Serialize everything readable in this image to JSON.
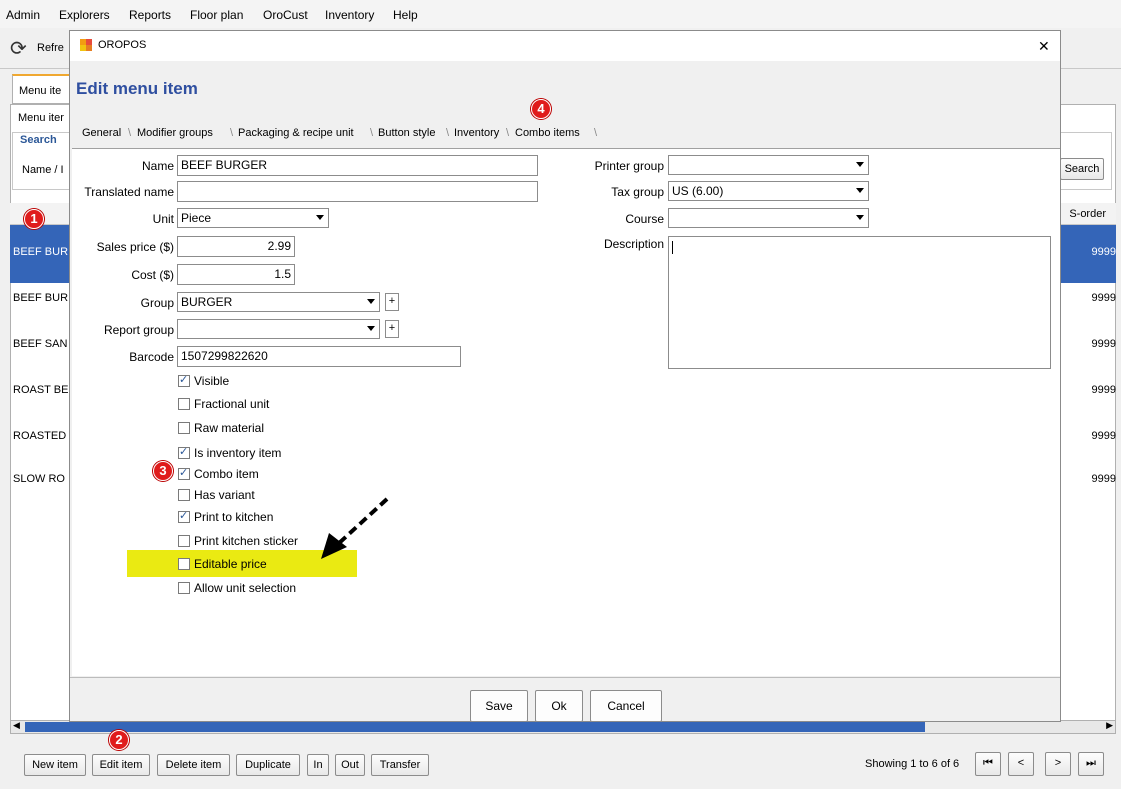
{
  "menubar": [
    "Admin",
    "Explorers",
    "Reports",
    "Floor plan",
    "OroCust",
    "Inventory",
    "Help"
  ],
  "toolbar": {
    "refresh_label": "Refre"
  },
  "background": {
    "tab_label": "Menu ite",
    "sub_label": "Menu iter",
    "search_group": "Search",
    "name_label": "Name / I",
    "search_button": "Search",
    "column_header": "S-order",
    "rows": [
      {
        "name": "BEEF BUR",
        "sort": "9999"
      },
      {
        "name": "BEEF BUR",
        "sort": "9999"
      },
      {
        "name": "BEEF SAN",
        "sort": "9999"
      },
      {
        "name": "ROAST BE",
        "sort": "9999"
      },
      {
        "name": "ROASTED",
        "sort": "9999"
      },
      {
        "name": "SLOW RO",
        "sort": "9999"
      }
    ],
    "bottom_buttons": [
      "New item",
      "Edit item",
      "Delete item",
      "Duplicate",
      "In",
      "Out",
      "Transfer"
    ],
    "paging_text": "Showing 1 to 6 of 6",
    "paging_icons": [
      "⏮",
      "<",
      ">",
      "⏭"
    ]
  },
  "dialog": {
    "window_title": "OROPOS",
    "close_glyph": "✕",
    "heading": "Edit menu item",
    "tabs": [
      "General",
      "Modifier groups",
      "Packaging & recipe unit",
      "Button style",
      "Inventory",
      "Combo items"
    ],
    "fields": {
      "name": {
        "label": "Name",
        "value": "BEEF BURGER"
      },
      "translated_name": {
        "label": "Translated name",
        "value": ""
      },
      "unit": {
        "label": "Unit",
        "value": "Piece"
      },
      "sales_price": {
        "label": "Sales price ($)",
        "value": "2.99"
      },
      "cost": {
        "label": "Cost ($)",
        "value": "1.5"
      },
      "group": {
        "label": "Group",
        "value": "BURGER",
        "plus": "+"
      },
      "report_group": {
        "label": "Report group",
        "value": "",
        "plus": "+"
      },
      "barcode": {
        "label": "Barcode",
        "value": "1507299822620"
      },
      "printer_group": {
        "label": "Printer group",
        "value": ""
      },
      "tax_group": {
        "label": "Tax group",
        "value": "US (6.00)"
      },
      "course": {
        "label": "Course",
        "value": ""
      },
      "description": {
        "label": "Description",
        "value": ""
      }
    },
    "checkboxes": [
      {
        "label": "Visible",
        "checked": true
      },
      {
        "label": "Fractional unit",
        "checked": false
      },
      {
        "label": "Raw material",
        "checked": false
      },
      {
        "label": "Is inventory item",
        "checked": true
      },
      {
        "label": "Combo item",
        "checked": true
      },
      {
        "label": "Has variant",
        "checked": false
      },
      {
        "label": "Print to kitchen",
        "checked": true
      },
      {
        "label": "Print kitchen sticker",
        "checked": false
      },
      {
        "label": "Editable price",
        "checked": false
      },
      {
        "label": "Allow unit selection",
        "checked": false
      }
    ],
    "footer_buttons": [
      "Save",
      "Ok",
      "Cancel"
    ]
  },
  "annotations": {
    "badges": [
      "1",
      "2",
      "3",
      "4"
    ],
    "highlight_color": "#eaea12"
  },
  "colors": {
    "accent": "#2b5797",
    "selected_row": "#3465b8",
    "heading": "#2f4fa0",
    "badge": "#e01b1b"
  }
}
